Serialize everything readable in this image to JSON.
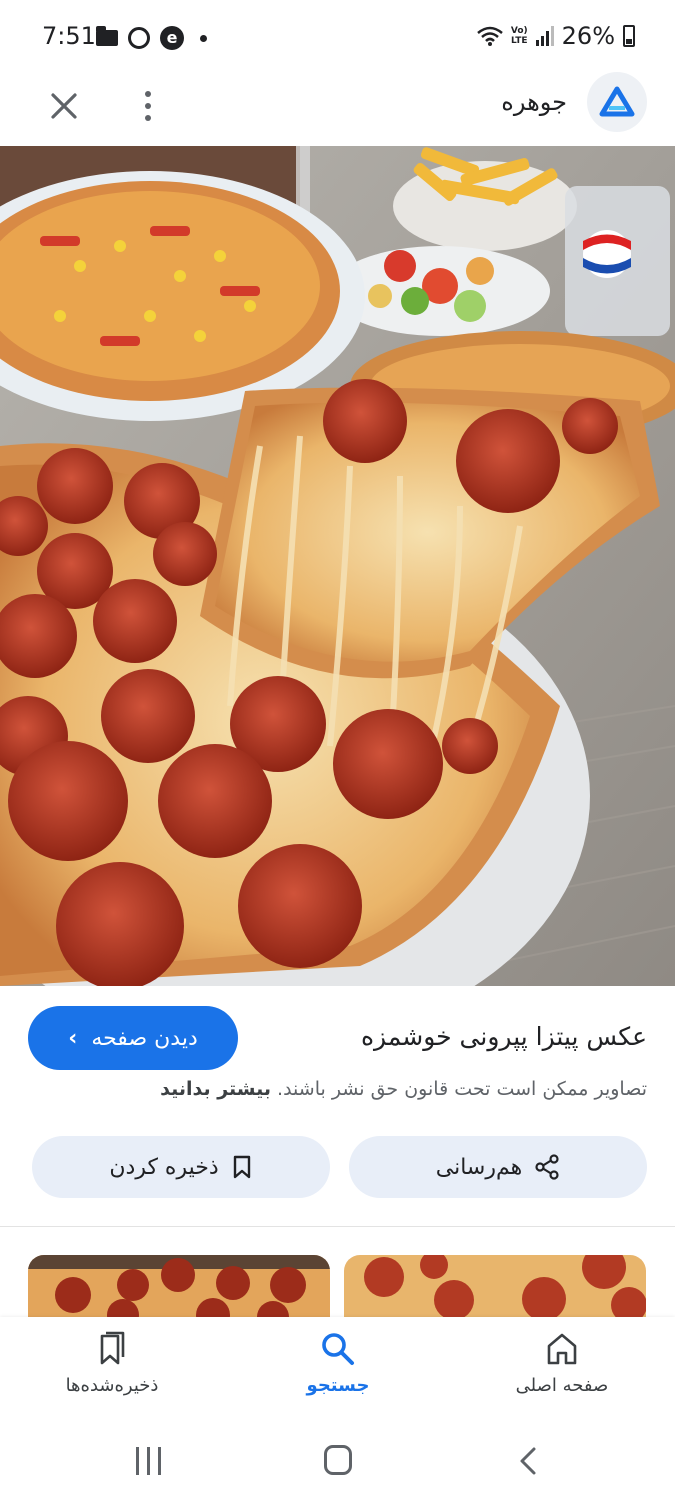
{
  "status_bar": {
    "time": "7:51",
    "volte_top": "Vo)",
    "volte_bottom": "LTE",
    "battery": "26%"
  },
  "app_bar": {
    "app_name": "جوهره",
    "icons": [
      "close-icon",
      "more-vert-icon",
      "app-logo"
    ]
  },
  "image": {
    "alt_icon": "pizza-photo"
  },
  "info": {
    "title": "عکس پیتزا پپرونی خوشمزه",
    "visit_button": "دیدن صفحه",
    "copyright_text": "تصاویر ممکن است تحت قانون حق نشر باشند.",
    "learn_more": "بیشتر بدانید"
  },
  "actions": {
    "share_label": "هم‌رسانی",
    "save_label": "ذخیره کردن"
  },
  "bottom_nav": {
    "items": [
      {
        "label": "صفحه اصلی",
        "icon": "home-icon"
      },
      {
        "label": "جستجو",
        "icon": "search-icon",
        "active": true
      },
      {
        "label": "ذخیره‌شده‌ها",
        "icon": "bookmarks-icon"
      }
    ]
  },
  "colors": {
    "accent": "#1a73e8",
    "pill_bg": "#e8eef8"
  }
}
